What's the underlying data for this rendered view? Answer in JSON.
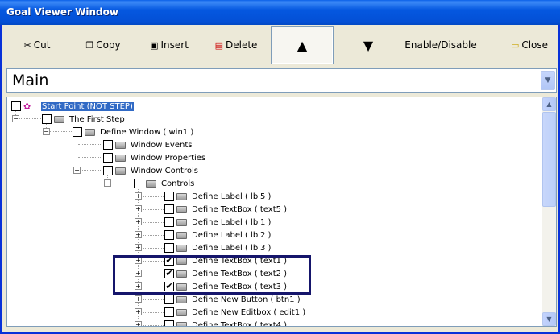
{
  "window": {
    "title": "Goal Viewer Window"
  },
  "toolbar": {
    "cut": "Cut",
    "copy": "Copy",
    "insert": "Insert",
    "delete": "Delete",
    "enable_disable": "Enable/Disable",
    "close": "Close"
  },
  "combo": {
    "selected": "Main"
  },
  "tree": {
    "root": "Start Point (NOT STEP)",
    "first_step": "The First Step",
    "define_window": "Define Window  ( win1 )",
    "window_events": "Window Events",
    "window_properties": "Window Properties",
    "window_controls": "Window Controls",
    "controls": "Controls",
    "items": [
      {
        "label": "Define Label ( lbl5 )",
        "checked": false
      },
      {
        "label": "Define TextBox  ( text5  )",
        "checked": false
      },
      {
        "label": "Define Label ( lbl1 )",
        "checked": false
      },
      {
        "label": "Define Label ( lbl2 )",
        "checked": false
      },
      {
        "label": "Define Label ( lbl3 )",
        "checked": false
      },
      {
        "label": "Define TextBox  ( text1  )",
        "checked": true
      },
      {
        "label": "Define TextBox  ( text2  )",
        "checked": true
      },
      {
        "label": "Define TextBox  ( text3  )",
        "checked": true
      },
      {
        "label": "Define New Button  ( btn1 )",
        "checked": false
      },
      {
        "label": "Define New Editbox  ( edit1 )",
        "checked": false
      },
      {
        "label": "Define TextBox  ( text4  )",
        "checked": false
      }
    ]
  },
  "icons": {
    "cut": "scissors-icon",
    "copy": "copy-icon",
    "insert": "insert-icon",
    "delete": "delete-icon",
    "move_up": "up-arrow-icon",
    "move_down": "down-arrow-icon",
    "close": "folder-icon"
  },
  "colors": {
    "titlebar": "#0558e0",
    "selection": "#316ac5",
    "highlight_box": "#15156b"
  }
}
